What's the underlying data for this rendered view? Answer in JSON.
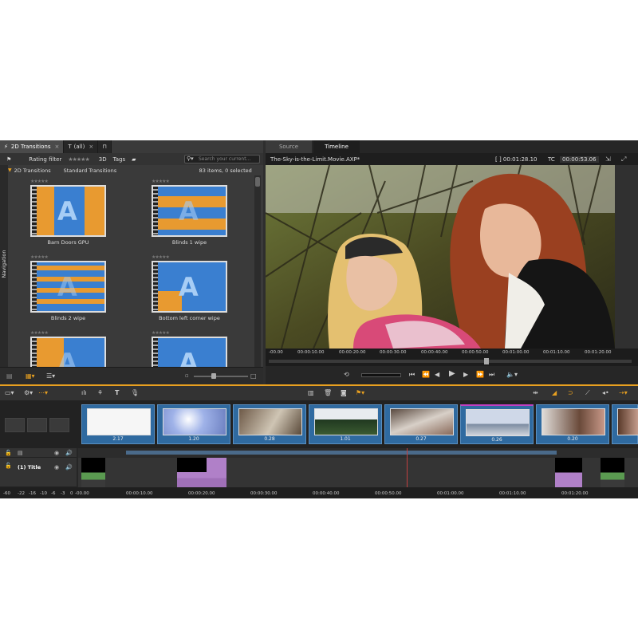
{
  "library": {
    "tabs": [
      {
        "label": "2D Transitions",
        "close": "×"
      },
      {
        "label": "(all)",
        "close": "×"
      }
    ],
    "filter": {
      "rating_label": "Rating filter",
      "stars": "★★★★★",
      "label_3d": "3D",
      "tags_label": "Tags"
    },
    "search_placeholder": "Search your current...",
    "section_title": "2D Transitions",
    "section_subtitle": "Standard Transitions",
    "count_text": "83 items, 0 selected",
    "nav_label": "Navigation",
    "items": [
      {
        "name": "Barn Doors GPU",
        "rating": "★★★★★"
      },
      {
        "name": "Blinds 1 wipe",
        "rating": "★★★★★"
      },
      {
        "name": "Blinds 2 wipe",
        "rating": "★★★★★"
      },
      {
        "name": "Bottom left corner wipe",
        "rating": "★★★★★"
      },
      {
        "name": "",
        "rating": "★★★★★"
      },
      {
        "name": "",
        "rating": "★★★★★"
      }
    ],
    "thumb_letter": "A"
  },
  "preview": {
    "tabs": [
      "Source",
      "Timeline"
    ],
    "project_name": "The-Sky-is-the-Limit.Movie.AXP*",
    "duration": "[ ] 00:01:28.10",
    "tc_label": "TC",
    "timecode": "00:00:53.06",
    "ruler_ticks": [
      "-00.00",
      "00:00:10.00",
      "00:00:20.00",
      "00:00:30.00",
      "00:00:40.00",
      "00:00:50.00",
      "00:01:00.00",
      "00:01:10.00",
      "00:01:20.00"
    ]
  },
  "timeline": {
    "clips": [
      {
        "duration": "2.17"
      },
      {
        "duration": "1.20"
      },
      {
        "duration": "0.28"
      },
      {
        "duration": "1.01"
      },
      {
        "duration": "0.27"
      },
      {
        "duration": "0.26"
      },
      {
        "duration": "0.20"
      }
    ],
    "track_name": "(1) Title",
    "ruler_ticks": [
      "-60",
      "-22",
      "-16",
      "-10",
      "-6",
      "-3",
      "0",
      "-00.00",
      "00:00:10.00",
      "00:00:20.00",
      "00:00:30.00",
      "00:00:40.00",
      "00:00:50.00",
      "00:01:00.00",
      "00:01:10.00",
      "00:01:20.00"
    ]
  },
  "colors": {
    "accent": "#e8a020",
    "clip_blue": "#2f6aa0",
    "thumb_orange": "#e89a30",
    "thumb_blue": "#3a7fd0"
  }
}
